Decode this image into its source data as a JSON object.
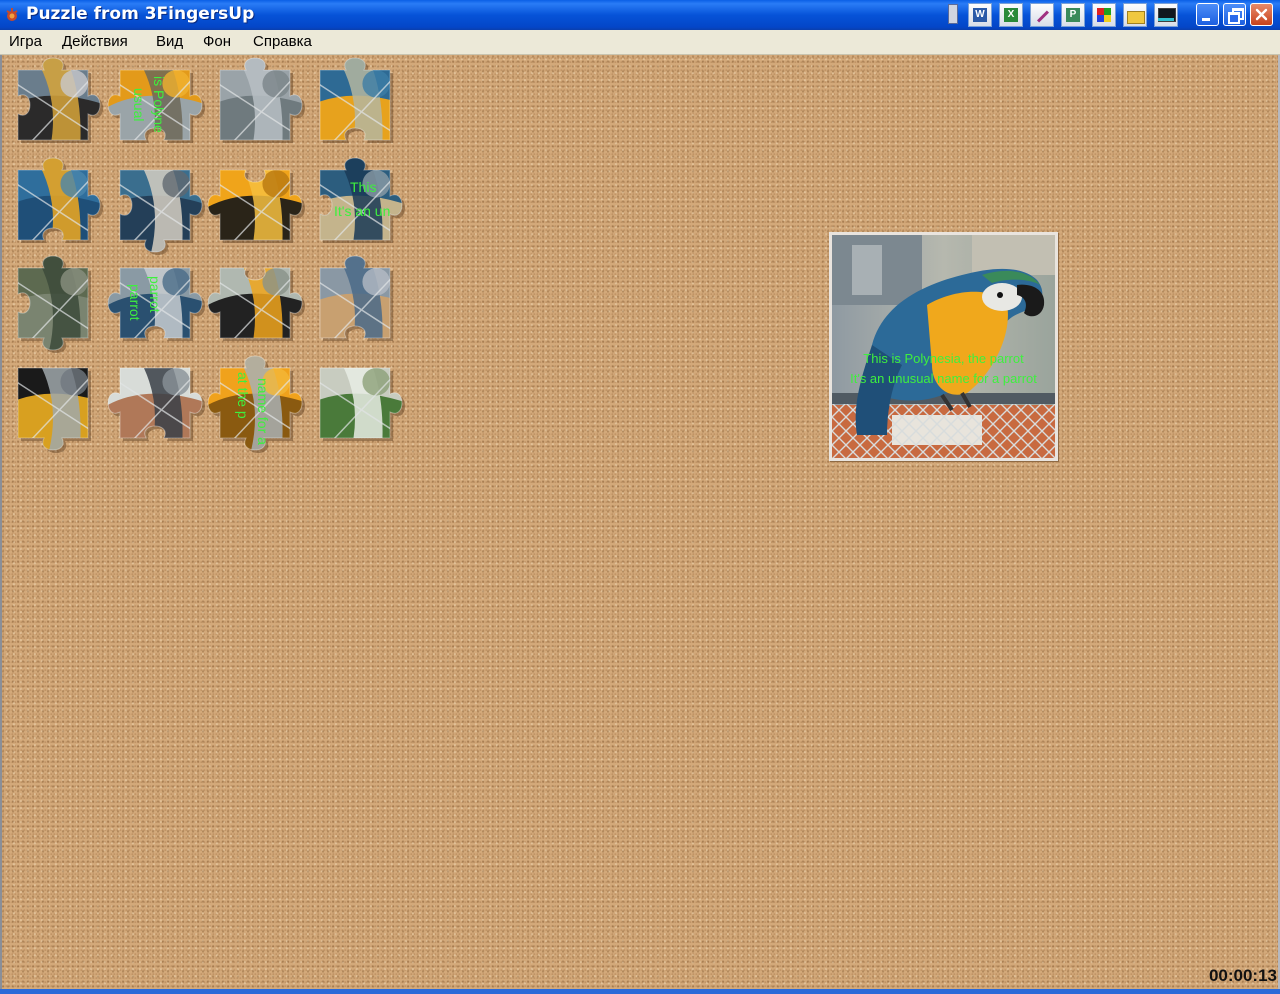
{
  "window": {
    "title": "Puzzle from 3FingersUp"
  },
  "tray_icons": [
    "app-tray-icon",
    "word-icon",
    "excel-icon",
    "paint-icon",
    "project-icon",
    "colors-icon",
    "folder-icon",
    "monitor-icon"
  ],
  "menu": {
    "items": [
      "Игра",
      "Действия",
      "Вид",
      "Фон",
      "Справка"
    ]
  },
  "pieces": [
    {
      "id": "r1c1",
      "colors": [
        "#6a7d8c",
        "#2b2a2a",
        "#d7a53a",
        "#c8c8cc"
      ],
      "text": ""
    },
    {
      "id": "r1c2",
      "colors": [
        "#e39a1a",
        "#9aa4a8",
        "#6d6858",
        "#f0b230"
      ],
      "text": "is Polyne",
      "text2": "usual"
    },
    {
      "id": "r1c3",
      "colors": [
        "#9aa3a8",
        "#6f7a7e",
        "#b8c0c4",
        "#7a8488"
      ],
      "text": ""
    },
    {
      "id": "r1c4",
      "colors": [
        "#2e6a94",
        "#e7a21d",
        "#b4b6a0",
        "#3c7da5"
      ],
      "text": ""
    },
    {
      "id": "r2c1",
      "colors": [
        "#2f6e9c",
        "#1f4f78",
        "#f0a81e",
        "#4a86ad"
      ],
      "text": ""
    },
    {
      "id": "r2c2",
      "colors": [
        "#3a6e8e",
        "#243f58",
        "#d6cfc2",
        "#606870"
      ],
      "text": ""
    },
    {
      "id": "r2c3",
      "colors": [
        "#f0a41a",
        "#2a2418",
        "#f6c040",
        "#b87810"
      ],
      "text": ""
    },
    {
      "id": "r2c4",
      "colors": [
        "#2c5d7e",
        "#c4b48c",
        "#1a3a56",
        "#8c9ca6"
      ],
      "text": "This",
      "text2": "It's an un"
    },
    {
      "id": "r3c1",
      "colors": [
        "#5d6a50",
        "#7a8470",
        "#3c4a3a",
        "#8a9080"
      ],
      "text": ""
    },
    {
      "id": "r3c2",
      "colors": [
        "#8a9aa4",
        "#2a5070",
        "#c8ccd0",
        "#4a6c88"
      ],
      "text": "parrot",
      "text2": "parrot"
    },
    {
      "id": "r3c3",
      "colors": [
        "#b0b8b0",
        "#222222",
        "#f0a51c",
        "#8a928a"
      ],
      "text": ""
    },
    {
      "id": "r3c4",
      "colors": [
        "#8a98a4",
        "#c8a070",
        "#4a6a88",
        "#b4bcc4"
      ],
      "text": ""
    },
    {
      "id": "r4c1",
      "colors": [
        "#1a1a1a",
        "#d8a020",
        "#a0a8ac",
        "#707880"
      ],
      "text": ""
    },
    {
      "id": "r4c2",
      "colors": [
        "#d8dcd8",
        "#b07858",
        "#3a4048",
        "#8a9298"
      ],
      "text": ""
    },
    {
      "id": "r4c3",
      "colors": [
        "#f0a21c",
        "#8a5a10",
        "#a8b0b4",
        "#f4b838"
      ],
      "text": "at the p",
      "text2": "name for a"
    },
    {
      "id": "r4c4",
      "colors": [
        "#c8ccc0",
        "#4a7a3a",
        "#e8ece4",
        "#8ca078"
      ],
      "text": ""
    }
  ],
  "preview": {
    "line1": "This is Polynesia, the parrot",
    "line2": "It's an unusual name for a parrot"
  },
  "timer": "00:00:13"
}
